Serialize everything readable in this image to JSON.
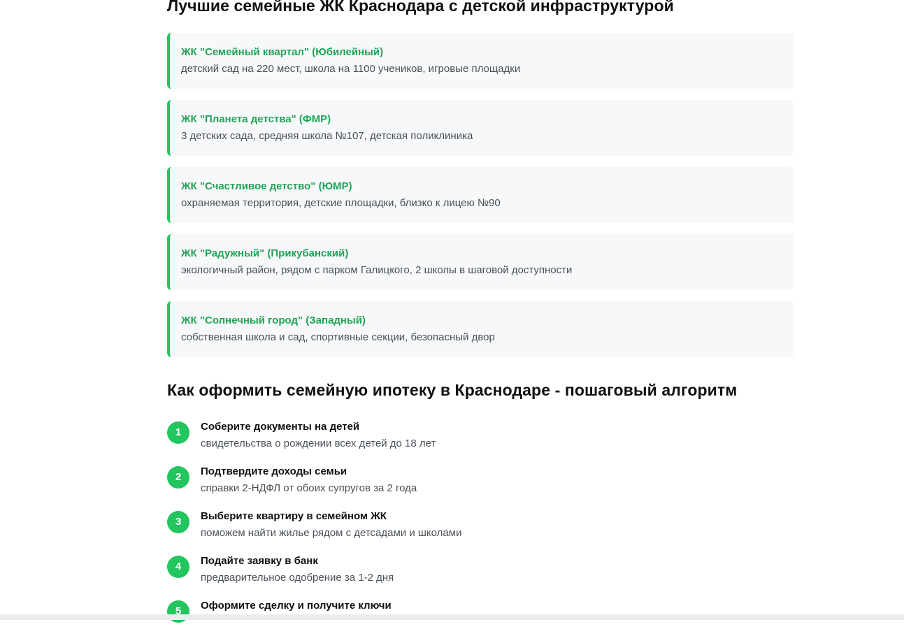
{
  "complexes_section": {
    "title": "Лучшие семейные ЖК Краснодара с детской инфраструктурой",
    "items": [
      {
        "name": "ЖК \"Семейный квартал\" (Юбилейный)",
        "desc": "детский сад на 220 мест, школа на 1100 учеников, игровые площадки"
      },
      {
        "name": "ЖК \"Планета детства\" (ФМР)",
        "desc": "3 детских сада, средняя школа №107, детская поликлиника"
      },
      {
        "name": "ЖК \"Счастливое детство\" (ЮМР)",
        "desc": "охраняемая территория, детские площадки, близко к лицею №90"
      },
      {
        "name": "ЖК \"Радужный\" (Прикубанский)",
        "desc": "экологичный район, рядом с парком Галицкого, 2 школы в шаговой доступности"
      },
      {
        "name": "ЖК \"Солнечный город\" (Западный)",
        "desc": "собственная школа и сад, спортивные секции, безопасный двор"
      }
    ]
  },
  "steps_section": {
    "title": "Как оформить семейную ипотеку в Краснодаре - пошаговый алгоритм",
    "steps": [
      {
        "num": "1",
        "title": "Соберите документы на детей",
        "desc": "свидетельства о рождении всех детей до 18 лет"
      },
      {
        "num": "2",
        "title": "Подтвердите доходы семьи",
        "desc": "справки 2-НДФЛ от обоих супругов за 2 года"
      },
      {
        "num": "3",
        "title": "Выберите квартиру в семейном ЖК",
        "desc": "поможем найти жилье рядом с детсадами и школами"
      },
      {
        "num": "4",
        "title": "Подайте заявку в банк",
        "desc": "предварительное одобрение за 1-2 дня"
      },
      {
        "num": "5",
        "title": "Оформите сделку и получите ключи",
        "desc": ""
      }
    ]
  },
  "colors": {
    "accent": "#22c55e",
    "complex_name": "#21a356",
    "card_background": "#f7f8fa",
    "muted_text": "#4a5058"
  }
}
